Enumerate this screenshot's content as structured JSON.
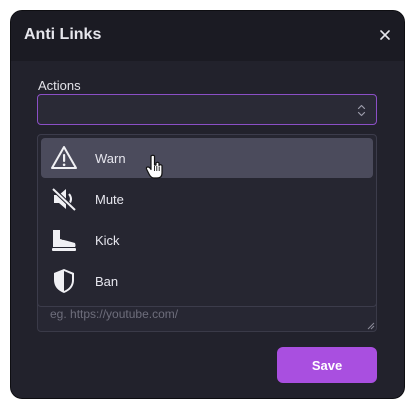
{
  "modal": {
    "title": "Anti Links",
    "close_icon": "close-icon"
  },
  "actions": {
    "label": "Actions",
    "selected_value": "",
    "options": [
      {
        "label": "Warn",
        "icon": "warning-icon",
        "highlighted": true
      },
      {
        "label": "Mute",
        "icon": "mute-icon",
        "highlighted": false
      },
      {
        "label": "Kick",
        "icon": "kick-boot-icon",
        "highlighted": false
      },
      {
        "label": "Ban",
        "icon": "shield-icon",
        "highlighted": false
      }
    ]
  },
  "links_field": {
    "placeholder": "eg. https://youtube.com/"
  },
  "footer": {
    "save_label": "Save"
  },
  "colors": {
    "accent": "#a94fe0",
    "focus_border": "#8b4fc6",
    "modal_bg": "#22222c",
    "header_bg": "#1b1b23"
  }
}
